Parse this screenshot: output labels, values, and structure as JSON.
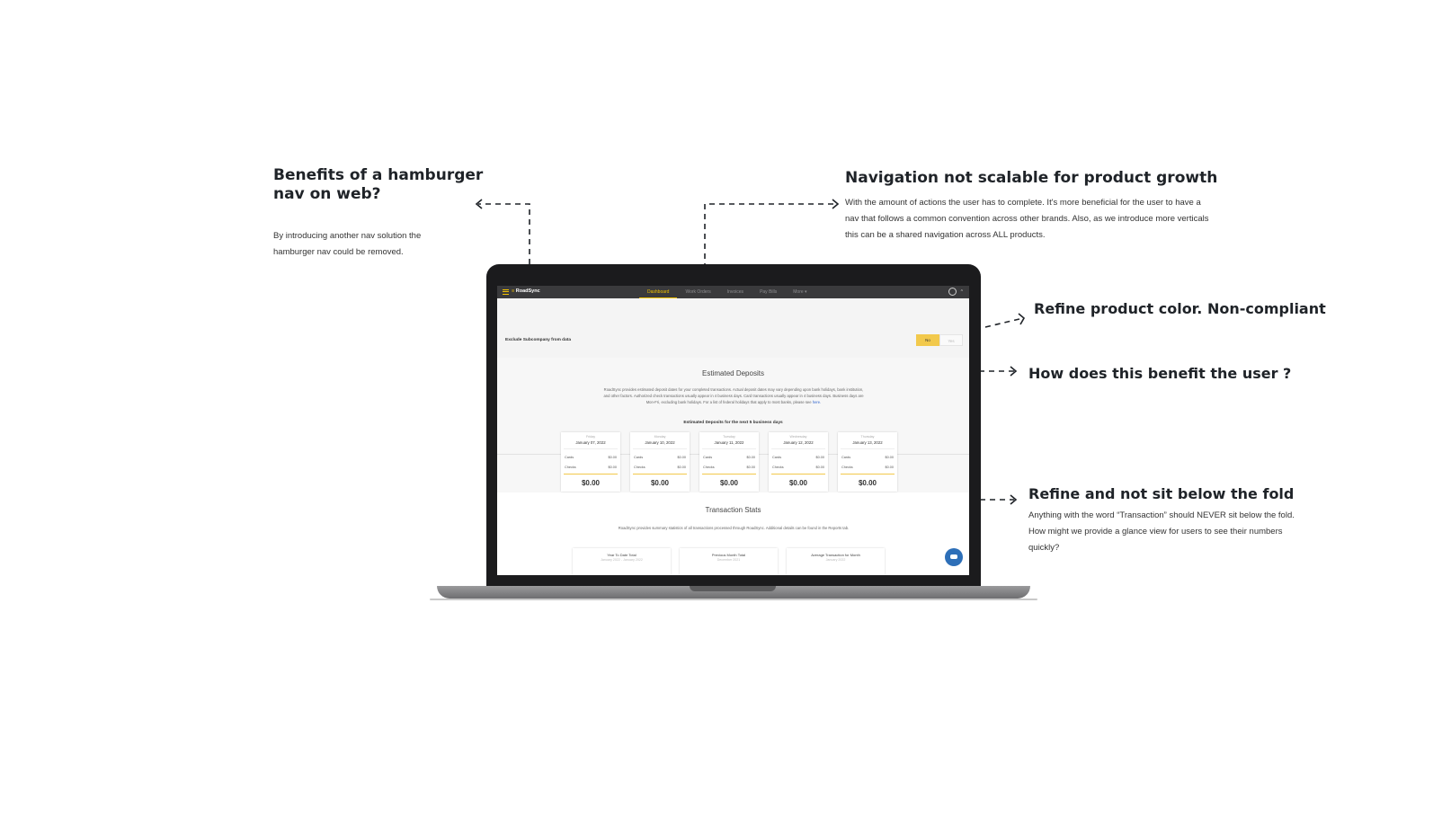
{
  "annotations": {
    "hamburger": {
      "title": "Benefits of a hamburger nav on web?",
      "body": "By introducing another nav solution the hamburger nav could be removed."
    },
    "navigation": {
      "title": "Navigation not scalable for product growth",
      "body": "With the amount of actions the user has to complete. It's more beneficial for the user to have a nav that follows a common convention across other brands. Also, as we introduce more verticals this can be a shared navigation across ALL products."
    },
    "color": {
      "title": "Refine product color. Non-compliant"
    },
    "benefit": {
      "title": "How does this benefit the user ?"
    },
    "fold": {
      "title": "Refine and not sit below the fold",
      "body": "Anything with the word “Transaction” should NEVER sit below the fold. How might we provide a glance view for users to see their numbers quickly?"
    }
  },
  "app": {
    "logo_prefix": "≡",
    "logo_text": "RoadSync",
    "nav": [
      "Dashboard",
      "Work Orders",
      "Invoices",
      "Pay Bills",
      "More ▾"
    ],
    "active_tab": "Dashboard",
    "exclude_label": "Exclude Subcompany from data",
    "toggle": {
      "no": "No",
      "yes": "Yes"
    },
    "deposits": {
      "title": "Estimated Deposits",
      "description": "RoadSync provides estimated deposit dates for your completed transactions. Actual deposit dates may vary depending upon bank holidays, bank institution, and other factors. Authorized check transactions usually appear in 4 business days. Card transactions usually appear in 4 business days. Business days are Mon-Fri, excluding bank holidays. For a list of federal holidays that apply to most banks, please see",
      "link": "here.",
      "subtitle": "Estimated Deposits for the next 5 business days",
      "cards": [
        {
          "day": "Friday",
          "date": "January 07, 2022",
          "cards_label": "Cards",
          "cards": "$0.00",
          "checks_label": "Checks",
          "checks": "$0.00",
          "total": "$0.00"
        },
        {
          "day": "Monday",
          "date": "January 10, 2022",
          "cards_label": "Cards",
          "cards": "$0.00",
          "checks_label": "Checks",
          "checks": "$0.00",
          "total": "$0.00"
        },
        {
          "day": "Tuesday",
          "date": "January 11, 2022",
          "cards_label": "Cards",
          "cards": "$0.00",
          "checks_label": "Checks",
          "checks": "$0.00",
          "total": "$0.00"
        },
        {
          "day": "Wednesday",
          "date": "January 12, 2022",
          "cards_label": "Cards",
          "cards": "$0.00",
          "checks_label": "Checks",
          "checks": "$0.00",
          "total": "$0.00"
        },
        {
          "day": "Thursday",
          "date": "January 13, 2022",
          "cards_label": "Cards",
          "cards": "$0.00",
          "checks_label": "Checks",
          "checks": "$0.00",
          "total": "$0.00"
        }
      ]
    },
    "stats": {
      "title": "Transaction Stats",
      "description": "RoadSync provides summary statistics of all transactions processed through RoadSync. Additional details can be found in the Reports tab.",
      "items": [
        {
          "label": "Year To Date Total",
          "period": "January 2022 - January 2022"
        },
        {
          "label": "Previous Month Total",
          "period": "December 2021"
        },
        {
          "label": "Average Transaction for Month",
          "period": "January 2022"
        }
      ]
    }
  },
  "colors": {
    "accent": "#f2c200",
    "toggle_selected": "#f2c94c",
    "chat": "#2d6fb8",
    "topbar": "#3a3a3c"
  }
}
